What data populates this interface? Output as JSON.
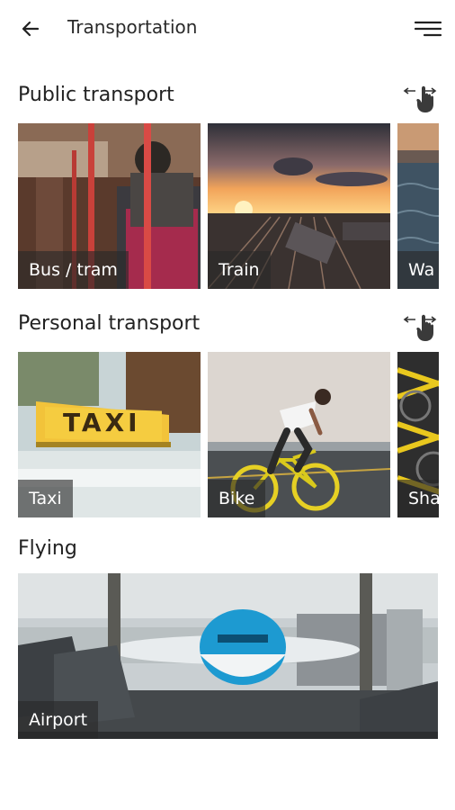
{
  "header": {
    "title": "Transportation",
    "back_icon": "arrow-left-icon",
    "menu_icon": "menu-icon"
  },
  "sections": [
    {
      "title": "Public transport",
      "swipe_icon": "swipe-hand-icon",
      "cards": [
        {
          "label": "Bus / tram"
        },
        {
          "label": "Train"
        },
        {
          "label": "Wa"
        }
      ]
    },
    {
      "title": "Personal transport",
      "swipe_icon": "swipe-hand-icon",
      "cards": [
        {
          "label": "Taxi",
          "sign_text": "TAXI"
        },
        {
          "label": "Bike"
        },
        {
          "label": "Sha"
        }
      ]
    },
    {
      "title": "Flying",
      "cards": [
        {
          "label": "Airport"
        }
      ]
    }
  ],
  "colors": {
    "label_bg": "rgba(40,40,40,0.62)",
    "label_text": "#ffffff",
    "background": "#ffffff"
  }
}
